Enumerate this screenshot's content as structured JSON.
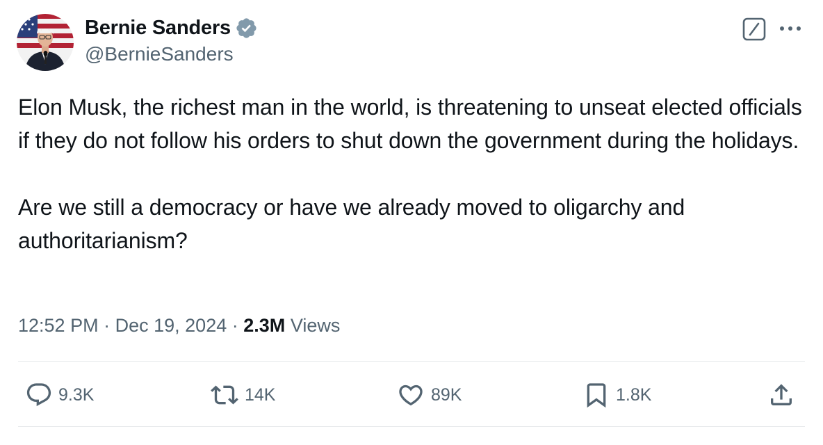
{
  "author": {
    "name": "Bernie Sanders",
    "handle": "@BernieSanders",
    "verified": true,
    "avatar_icon": "profile-photo-flag-background"
  },
  "header_actions": {
    "grok_icon": "grok-icon",
    "more_icon": "more-dots-icon"
  },
  "tweet": {
    "paragraphs": [
      "Elon Musk, the richest man in the world, is threatening to unseat elected officials if they do not follow his orders to shut down the government during the holidays.",
      "Are we still a democracy or have we already moved to oligarchy and authoritarianism?"
    ]
  },
  "meta": {
    "time": "12:52 PM",
    "separator": "·",
    "date": "Dec 19, 2024",
    "views_count": "2.3M",
    "views_label": "Views"
  },
  "actions": {
    "replies": "9.3K",
    "reposts": "14K",
    "likes": "89K",
    "bookmarks": "1.8K",
    "share_icon": "share-icon"
  },
  "colors": {
    "text_primary": "#0f1419",
    "text_secondary": "#536471",
    "divider": "#e6e9eb",
    "verified_badge": "#829aab"
  }
}
